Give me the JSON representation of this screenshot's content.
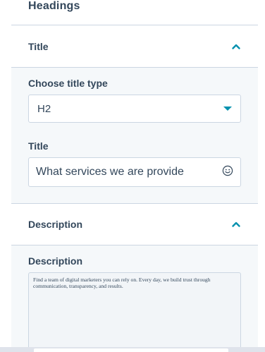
{
  "panel": {
    "heading": "Headings"
  },
  "title_section": {
    "header_label": "Title",
    "title_type": {
      "label": "Choose title type",
      "selected": "H2"
    },
    "title_field": {
      "label": "Title",
      "value": "What services we are provide"
    }
  },
  "description_section": {
    "header_label": "Description",
    "field_label": "Description",
    "value": "Find a team of digital marketers you can rely on. Every day, we build trust through communication, transparency, and results."
  },
  "icons": {
    "collapse": "chevron-up-icon",
    "dropdown": "caret-down-icon",
    "emoji": "smiley-icon"
  },
  "colors": {
    "accent": "#0091ae",
    "text": "#33475b",
    "border": "#cbd6e2",
    "section_bg": "#f5f8fa"
  }
}
